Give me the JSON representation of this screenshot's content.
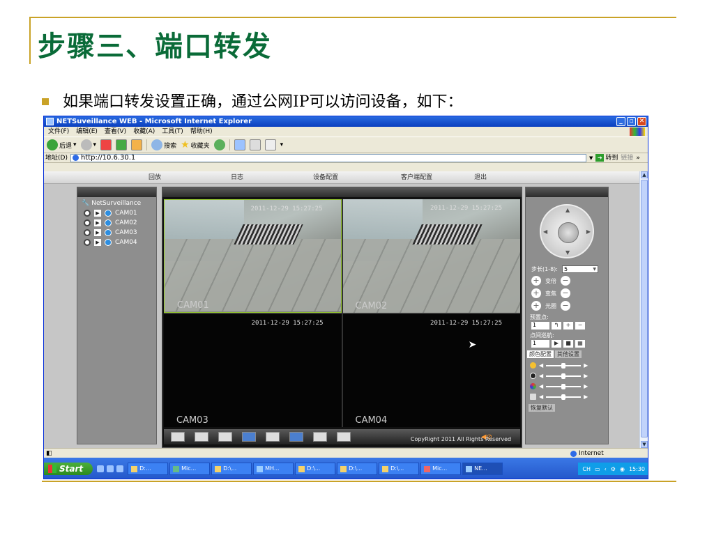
{
  "slide": {
    "title": "步骤三、端口转发",
    "bullet": "如果端口转发设置正确，通过公网IP可以访问设备，如下："
  },
  "browser": {
    "title": "NETSuveillance WEB - Microsoft Internet Explorer",
    "menu": [
      "文件(F)",
      "编辑(E)",
      "查看(V)",
      "收藏(A)",
      "工具(T)",
      "帮助(H)"
    ],
    "toolbar": {
      "back": "后退",
      "search": "搜索",
      "favorites": "收藏夹"
    },
    "address_label": "地址(D)",
    "address": "http://10.6.30.1",
    "go": "转到",
    "links": "链接",
    "more": "»",
    "status_zone": "Internet"
  },
  "webapp": {
    "nav": [
      "回放",
      "日志",
      "设备配置",
      "客户端配置",
      "退出"
    ],
    "device_root": "NetSurveillance",
    "cameras": [
      "CAM01",
      "CAM02",
      "CAM03",
      "CAM04"
    ],
    "timestamp": "2011-12-29 15:27:25",
    "copyright": "CopyRight 2011 All Rights Reserved",
    "ptz": {
      "step_label": "步长(1-8):",
      "step_value": "5",
      "zoom": "变倍",
      "focus": "变焦",
      "iris": "光圈",
      "preset_label": "预置点:",
      "preset_value": "1",
      "cruise_label": "点间巡航:",
      "cruise_value": "1",
      "tab_color": "颜色配置",
      "tab_other": "其他设置",
      "reset": "恢复默认"
    }
  },
  "taskbar": {
    "start": "Start",
    "tasks": [
      "D:...",
      "Mic...",
      "D:\\...",
      "MH...",
      "D:\\...",
      "D:\\...",
      "D:\\...",
      "Mic...",
      "NE..."
    ],
    "lang": "CH",
    "clock": "15:30"
  }
}
